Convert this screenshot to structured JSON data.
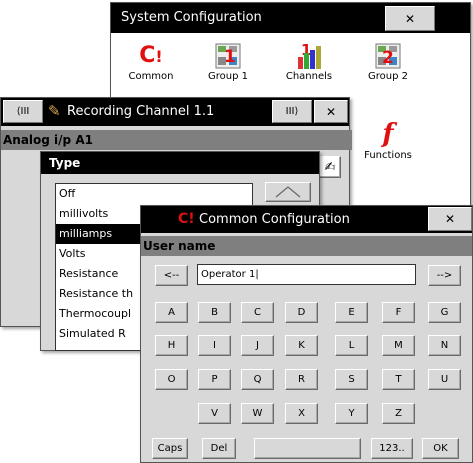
{
  "system": {
    "title": "System Configuration",
    "close": "✕",
    "items": [
      {
        "label": "Common",
        "icon": "common-config-icon"
      },
      {
        "label": "Group 1",
        "icon": "group1-icon"
      },
      {
        "label": "Channels",
        "icon": "channels-icon"
      },
      {
        "label": "Group 2",
        "icon": "group2-icon"
      },
      {
        "label": "Functions",
        "icon": "functions-icon"
      }
    ]
  },
  "recording": {
    "title": "Recording Channel 1.1",
    "prev": "⟨III",
    "next": "III⟩",
    "close": "✕",
    "section": "Analog i/p A1"
  },
  "type_dialog": {
    "title": "Type",
    "options": [
      "Off",
      "millivolts",
      "milliamps",
      "Volts",
      "Resistance",
      "Resistance th",
      "Thermocoupl",
      "Simulated R"
    ],
    "selected_index": 2
  },
  "common": {
    "title": "Common Configuration",
    "close": "✕",
    "field_label": "User name",
    "value": "Operator 1",
    "left_arrow": "<--",
    "right_arrow": "-->",
    "rows": [
      [
        "A",
        "B",
        "C",
        "D",
        "E",
        "F",
        "G"
      ],
      [
        "H",
        "I",
        "J",
        "K",
        "L",
        "M",
        "N"
      ],
      [
        "O",
        "P",
        "Q",
        "R",
        "S",
        "T",
        "U"
      ],
      [
        "V",
        "W",
        "X",
        "Y",
        "Z"
      ]
    ],
    "caps": "Caps",
    "del": "Del",
    "num": "123..",
    "ok": "OK"
  },
  "colors": {
    "titlebar": "#000000",
    "button_face": "#d8d8d8",
    "accent_red": "#e01010"
  }
}
